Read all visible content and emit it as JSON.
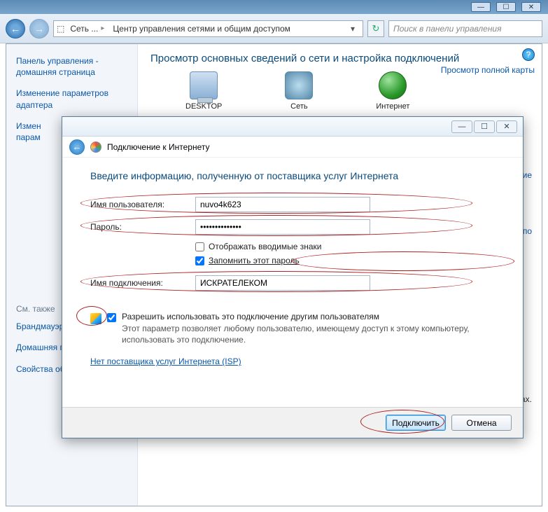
{
  "addressbar": {
    "seg1": "Сеть ...",
    "seg2": "Центр управления сетями и общим доступом"
  },
  "search": {
    "placeholder": "Поиск в панели управления"
  },
  "sidebar": {
    "home": "Панель управления -\nдомашняя страница",
    "adapter": "Изменение параметров адаптера",
    "sharing": "Измен\nпарам",
    "see_also_hdr": "См. также",
    "firewall": "Брандмауэр Windows",
    "homegroup": "Домашняя группа",
    "internet_opts": "Свойства обозревателя"
  },
  "main": {
    "heading": "Просмотр основных сведений о сети и настройка подключений",
    "map_link": "Просмотр полной карты",
    "node_pc": "DESKTOP",
    "node_net": "Сеть",
    "node_inet": "Интернет",
    "link_conn": "ключение",
    "link_net": "ние по\nсети",
    "link_params": "терах."
  },
  "dialog": {
    "title": "Подключение к Интернету",
    "heading": "Введите информацию, полученную от поставщика услуг Интернета",
    "lbl_user": "Имя пользователя:",
    "val_user": "nuvo4k623",
    "lbl_pass": "Пароль:",
    "val_pass": "••••••••••••••",
    "chk_show": "Отображать вводимые знаки",
    "chk_remember": "Запомнить этот пароль",
    "lbl_conn": "Имя подключения:",
    "val_conn": "ИСКРАТЕЛЕКОМ",
    "chk_share": "Разрешить использовать это подключение другим пользователям",
    "share_desc": "Этот параметр позволяет любому пользователю, имеющему доступ к этому компьютеру, использовать это подключение.",
    "isp_link": "Нет поставщика услуг Интернета (ISP)",
    "btn_connect": "Подключить",
    "btn_cancel": "Отмена"
  }
}
